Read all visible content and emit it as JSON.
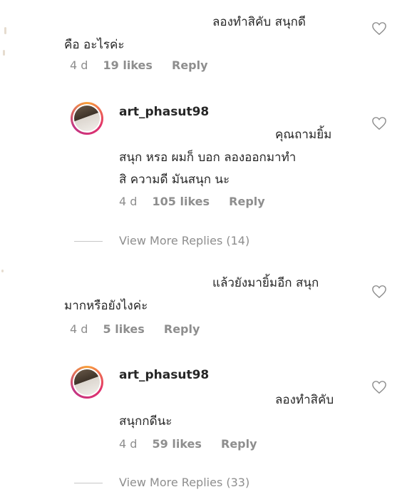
{
  "comments": [
    {
      "line1": "ลองทำสิคับ สนุกดี",
      "line2": "คือ อะไรค่ะ",
      "time": "4 d",
      "likes": "19 likes",
      "reply": "Reply"
    },
    {
      "line1": "แล้วยังมายิ้มอีก สนุก",
      "line2": "มากหรือยังไงค่ะ",
      "time": "4 d",
      "likes": "5 likes",
      "reply": "Reply"
    }
  ],
  "replies": [
    {
      "username": "art_phasut98",
      "line1": "คุณถามยิ้ม",
      "line2": "สนุก หรอ ผมก็ บอก ลองออกมาทำ",
      "line3": "สิ ความดี มันสนุก นะ",
      "time": "4 d",
      "likes": "105 likes",
      "reply": "Reply"
    },
    {
      "username": "art_phasut98",
      "line1": "ลองทำสิคับ",
      "line2": "สนุกกดีนะ",
      "time": "4 d",
      "likes": "59 likes",
      "reply": "Reply"
    }
  ],
  "view_more": [
    "View More Replies (14)",
    "View More Replies (33)"
  ],
  "colors": {
    "text": "#262626",
    "meta": "#8e8e8e",
    "heart_stroke": "#8e8e8e"
  }
}
